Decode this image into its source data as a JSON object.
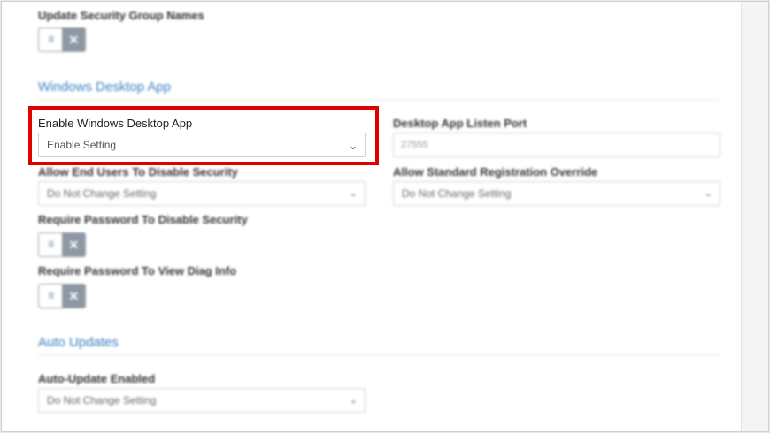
{
  "security": {
    "update_group_names_label": "Update Security Group Names"
  },
  "windows_desktop": {
    "section_title": "Windows Desktop App",
    "enable_label": "Enable Windows Desktop App",
    "enable_value": "Enable Setting",
    "listen_port_label": "Desktop App Listen Port",
    "listen_port_value": "27555",
    "allow_disable_label": "Allow End Users To Disable Security",
    "allow_disable_value": "Do Not Change Setting",
    "allow_std_reg_label": "Allow Standard Registration Override",
    "allow_std_reg_value": "Do Not Change Setting",
    "require_pw_disable_label": "Require Password To Disable Security",
    "require_pw_diag_label": "Require Password To View Diag Info"
  },
  "auto_updates": {
    "section_title": "Auto Updates",
    "enabled_label": "Auto-Update Enabled",
    "enabled_value": "Do Not Change Setting"
  },
  "icons": {
    "toggle_off": "close-icon",
    "select": "chevron-down-icon",
    "grip": "grip-icon"
  },
  "colors": {
    "section_blue": "#3a7fc2",
    "highlight_red": "#e00000",
    "toggle_gray": "#8d98a4"
  }
}
